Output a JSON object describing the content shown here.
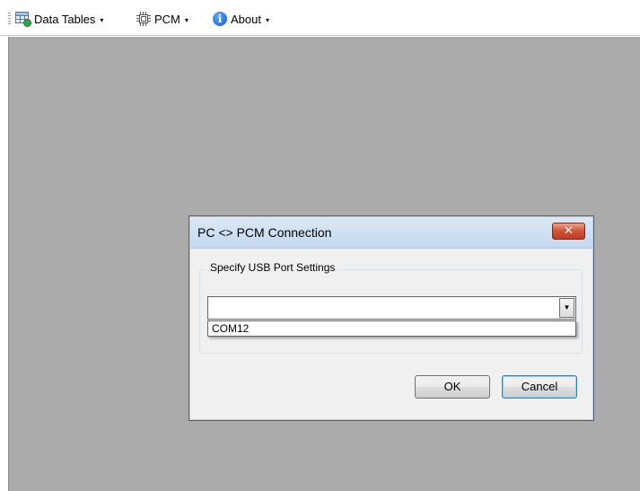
{
  "toolbar": {
    "items": [
      {
        "label": "Data Tables",
        "icon": "table-add-icon"
      },
      {
        "label": "PCM",
        "icon": "chip-icon"
      },
      {
        "label": "About",
        "icon": "info-icon"
      }
    ],
    "dropdown_arrow": "▾"
  },
  "dialog": {
    "title": "PC <> PCM Connection",
    "close_glyph": "✕",
    "group_label": "Specify USB Port Settings",
    "combo": {
      "value": "",
      "button_glyph": "▼",
      "options": [
        "COM12"
      ]
    },
    "ok_label": "OK",
    "cancel_label": "Cancel"
  },
  "colors": {
    "client_background": "#ababab",
    "titlebar_start": "#dbe8f6",
    "close_button": "#c23b22"
  }
}
